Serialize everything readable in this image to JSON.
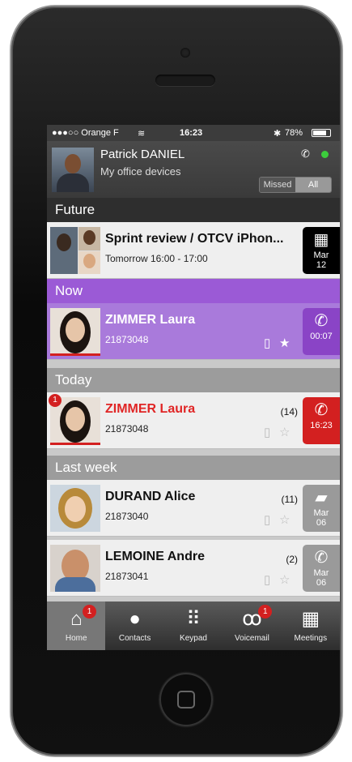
{
  "status_bar": {
    "carrier": "●●●○○ Orange F",
    "wifi_icon": "wifi-icon",
    "time": "16:23",
    "bluetooth": "✱",
    "battery": "78%"
  },
  "header": {
    "name": "Patrick DANIEL",
    "subtitle": "My office devices",
    "filter": {
      "missed": "Missed",
      "all": "All"
    },
    "presence_color": "#3ccd3c"
  },
  "sections": {
    "future": "Future",
    "now": "Now",
    "today": "Today",
    "last_week": "Last week"
  },
  "future_item": {
    "title": "Sprint review / OTCV iPhon...",
    "time": "Tomorrow 16:00 - 17:00",
    "badge_month": "Mar",
    "badge_day": "12"
  },
  "now_item": {
    "name": "ZIMMER Laura",
    "number": "21873048",
    "duration": "00:07"
  },
  "today_item": {
    "name": "ZIMMER Laura",
    "number": "21873048",
    "count": "(14)",
    "time": "16:23",
    "unread": "1"
  },
  "last_week": [
    {
      "name": "DURAND Alice",
      "number": "21873040",
      "count": "(11)",
      "month": "Mar",
      "day": "06"
    },
    {
      "name": "LEMOINE Andre",
      "number": "21873041",
      "count": "(2)",
      "month": "Mar",
      "day": "06"
    }
  ],
  "tabs": [
    {
      "label": "Home",
      "badge": "1"
    },
    {
      "label": "Contacts"
    },
    {
      "label": "Keypad"
    },
    {
      "label": "Voicemail",
      "badge": "1"
    },
    {
      "label": "Meetings"
    }
  ],
  "colors": {
    "accent_purple": "#9b5ad6",
    "alert_red": "#d32020"
  }
}
